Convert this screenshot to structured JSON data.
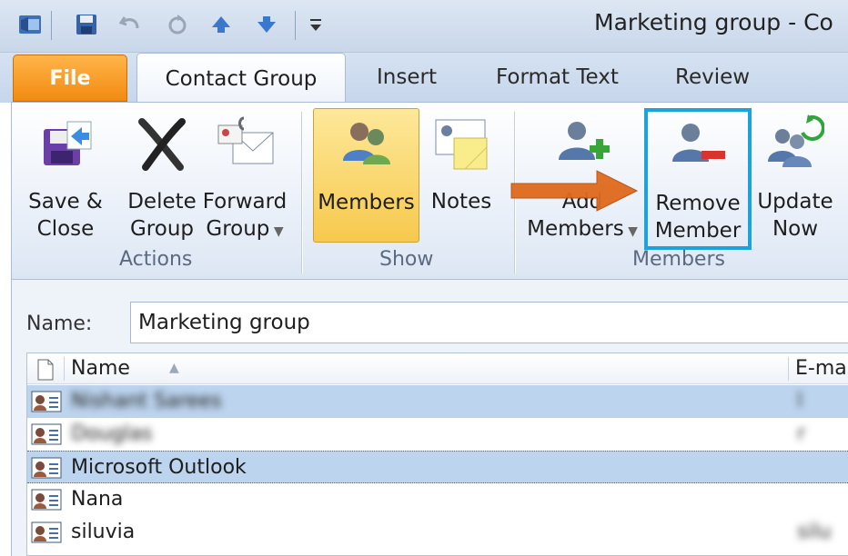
{
  "window": {
    "title": "Marketing group  -  Co"
  },
  "quick_access": {
    "icons": [
      "outlook-app-icon",
      "save-icon",
      "undo-icon",
      "redo-icon",
      "up-arrow-icon",
      "down-arrow-icon",
      "customize-icon"
    ]
  },
  "tabs": {
    "file": "File",
    "contact_group": "Contact Group",
    "insert": "Insert",
    "format_text": "Format Text",
    "review": "Review"
  },
  "ribbon": {
    "actions": {
      "label": "Actions",
      "save_close": [
        "Save &",
        "Close"
      ],
      "delete_group": [
        "Delete",
        "Group"
      ],
      "forward_group": [
        "Forward",
        "Group"
      ]
    },
    "show": {
      "label": "Show",
      "members": "Members",
      "notes": "Notes"
    },
    "members": {
      "label": "Members",
      "add_members": [
        "Add",
        "Members"
      ],
      "remove_member": [
        "Remove",
        "Member"
      ],
      "update_now": [
        "Update",
        "Now"
      ]
    }
  },
  "form": {
    "name_label": "Name:",
    "name_value": "Marketing group"
  },
  "list": {
    "columns": {
      "name": "Name",
      "email": "E-ma"
    },
    "rows": [
      {
        "name": "Nishant Sarees",
        "email": "l",
        "blurred": true,
        "selected": true
      },
      {
        "name": "Douglas",
        "email": "r",
        "blurred": true,
        "selected": false
      },
      {
        "name": "Microsoft Outlook",
        "email": "",
        "blurred": false,
        "selected": true,
        "focused": true
      },
      {
        "name": "Nana",
        "email": "",
        "blurred": false,
        "selected": false
      },
      {
        "name": "siluvia",
        "email": "silu",
        "blurred": false,
        "selected": false
      }
    ]
  },
  "colors": {
    "file_tab": "#f28a11",
    "selected_row": "#bcd4ee",
    "highlight_box": "#1aa3dc",
    "annotation_arrow": "#e06a1c"
  }
}
